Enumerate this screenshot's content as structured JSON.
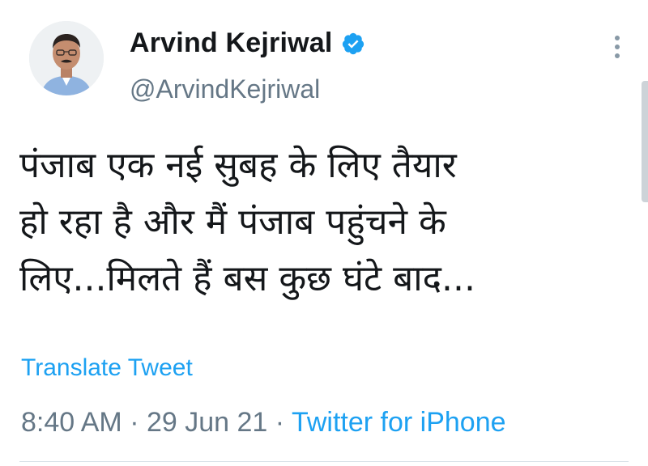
{
  "author": {
    "display_name": "Arvind Kejriwal",
    "handle": "@ArvindKejriwal",
    "verified": true
  },
  "tweet": {
    "text": "पंजाब एक नई सुबह के लिए तैयार\nहो रहा है और मैं पंजाब पहुंचने के\nलिए...मिलते हैं बस कुछ घंटे बाद..."
  },
  "translate_label": "Translate Tweet",
  "meta": {
    "time": "8:40 AM",
    "separator": "·",
    "date": "29 Jun 21",
    "source": "Twitter for iPhone"
  },
  "icons": {
    "verified": "verified-badge-icon",
    "more": "more-options-icon"
  },
  "colors": {
    "link": "#1da1f2",
    "secondary_text": "#657786",
    "primary_text": "#14171a"
  }
}
